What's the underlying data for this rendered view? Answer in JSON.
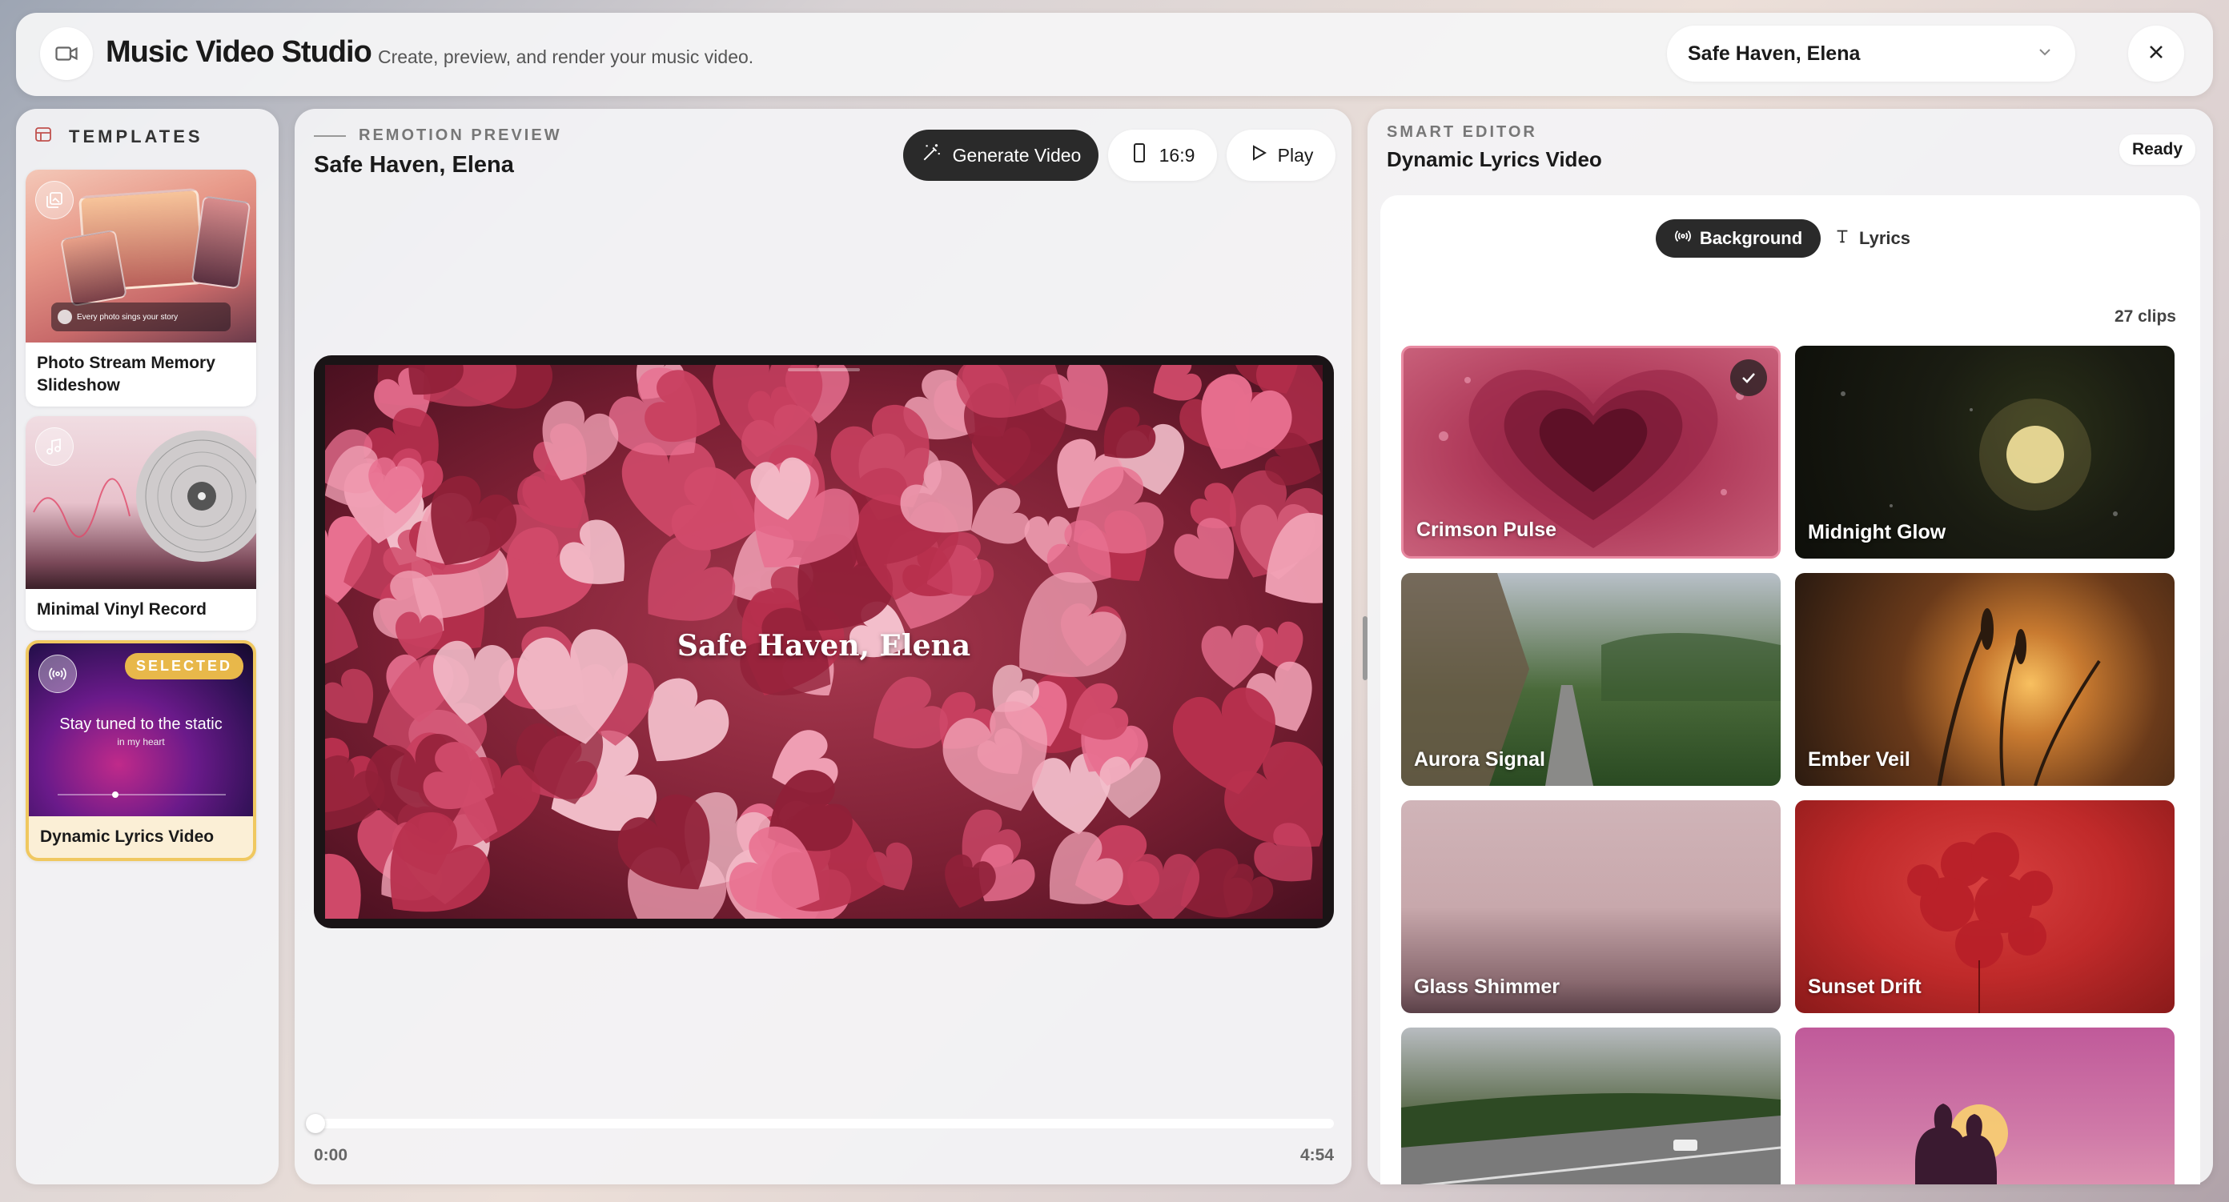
{
  "header": {
    "title": "Music Video Studio",
    "subtitle": "Create, preview, and render your music video.",
    "song_select": "Safe Haven, Elena"
  },
  "templates": {
    "heading": "TEMPLATES",
    "items": [
      {
        "title": "Photo Stream Memory Slideshow",
        "thumb_caption": "Every photo sings your story"
      },
      {
        "title": "Minimal Vinyl Record"
      },
      {
        "title": "Dynamic Lyrics Video",
        "badge": "SELECTED",
        "thumb_line1": "Stay tuned to the static",
        "thumb_line2": "in my heart"
      }
    ]
  },
  "preview": {
    "eyebrow": "REMOTION PREVIEW",
    "title": "Safe Haven, Elena",
    "generate_label": "Generate Video",
    "ratio_label": "16:9",
    "play_label": "Play",
    "video_title": "Safe Haven, Elena",
    "time_start": "0:00",
    "time_end": "4:54",
    "progress": 0
  },
  "editor": {
    "eyebrow": "SMART EDITOR",
    "title": "Dynamic Lyrics Video",
    "status": "Ready",
    "tabs": [
      {
        "label": "Background",
        "active": true
      },
      {
        "label": "Lyrics",
        "active": false
      }
    ],
    "clip_count": "27 clips",
    "clips": [
      {
        "name": "Crimson Pulse",
        "selected": true
      },
      {
        "name": "Midnight Glow"
      },
      {
        "name": "Aurora Signal"
      },
      {
        "name": "Ember Veil"
      },
      {
        "name": "Glass Shimmer"
      },
      {
        "name": "Sunset Drift"
      }
    ]
  },
  "colors": {
    "accent_dark": "#2a2a2a",
    "selected_gold": "#e8b84a",
    "crimson": "#a8384f"
  },
  "icons": [
    "video-camera-icon",
    "chevron-down-icon",
    "close-icon",
    "templates-icon",
    "gallery-icon",
    "music-note-icon",
    "broadcast-icon",
    "magic-wand-icon",
    "phone-icon",
    "play-icon",
    "text-icon",
    "check-icon"
  ]
}
